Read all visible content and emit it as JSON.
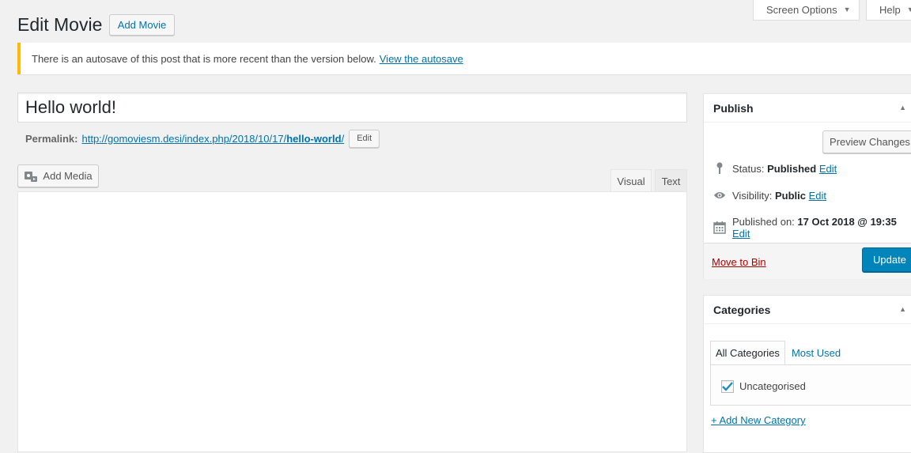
{
  "screen_meta": {
    "screen_options": "Screen Options",
    "help": "Help"
  },
  "header": {
    "title": "Edit Movie",
    "add_button": "Add Movie"
  },
  "notice": {
    "text": "There is an autosave of this post that is more recent than the version below.",
    "link": "View the autosave",
    "border_color": "#ffb900"
  },
  "post": {
    "title": "Hello world!",
    "permalink_label": "Permalink:",
    "permalink_base": "http://gomoviesm.desi/index.php/2018/10/17/",
    "permalink_slug": "hello-world",
    "permalink_end": "/",
    "permalink_edit": "Edit"
  },
  "editor": {
    "add_media": "Add Media",
    "tab_visual": "Visual",
    "tab_text": "Text"
  },
  "publish": {
    "heading": "Publish",
    "preview_button": "Preview Changes",
    "status_label": "Status:",
    "status_value": "Published",
    "visibility_label": "Visibility:",
    "visibility_value": "Public",
    "published_label": "Published on:",
    "published_value": "17 Oct 2018 @ 19:35",
    "edit_link": "Edit",
    "trash_link": "Move to Bin",
    "update_button": "Update",
    "accent_color": "#0085ba"
  },
  "categories": {
    "heading": "Categories",
    "tab_all": "All Categories",
    "tab_most_used": "Most Used",
    "items": [
      {
        "label": "Uncategorised",
        "checked": true
      }
    ],
    "add_new": "+ Add New Category"
  }
}
